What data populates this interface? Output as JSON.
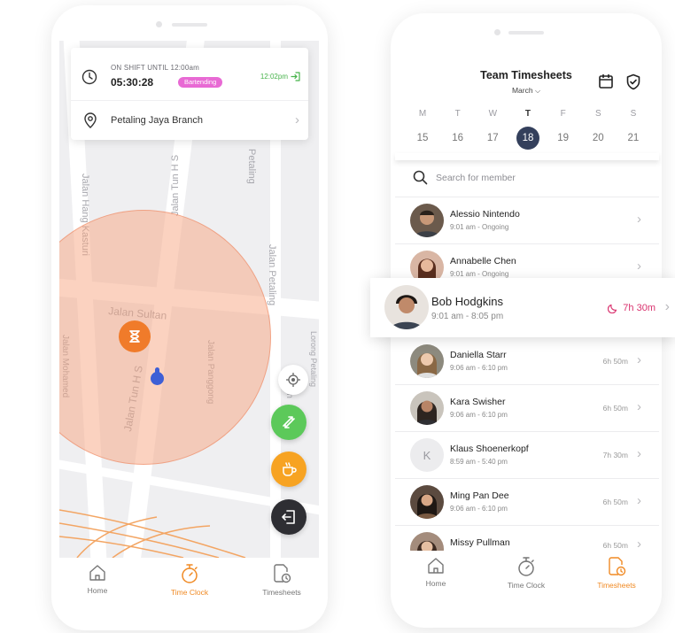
{
  "left_phone": {
    "shift": {
      "label": "ON SHIFT UNTIL 12:00am",
      "timer": "05:30:28",
      "role": "Bartending",
      "clock_in_time": "12:02pm"
    },
    "branch": {
      "name": "Petaling Jaya Branch"
    },
    "streets": {
      "hang_kasturi": "Jalan Hang Kasturi",
      "tun_hs_top": "Jalan Tun H S",
      "petaling_top": "Petaling",
      "sultan": "Jalan Sultan",
      "petaling": "Jalan Petaling",
      "tun_hs": "Jalan Tun H S",
      "panggong": "Jalan Panggong",
      "mohamed": "Jalan Mohamed",
      "lorong": "Lorong Petaling",
      "jalan_short": "Jalan"
    },
    "nav": [
      {
        "label": "Home"
      },
      {
        "label": "Time Clock"
      },
      {
        "label": "Timesheets"
      }
    ]
  },
  "right_phone": {
    "title": "Team Timesheets",
    "month": "March",
    "week": {
      "letters": [
        "M",
        "T",
        "W",
        "T",
        "F",
        "S",
        "S"
      ],
      "numbers": [
        "15",
        "16",
        "17",
        "18",
        "19",
        "20",
        "21"
      ]
    },
    "search": {
      "placeholder": "Search for member"
    },
    "members": [
      {
        "name": "Alessio Nintendo",
        "time": "9:01 am - Ongoing",
        "hours": ""
      },
      {
        "name": "Annabelle Chen",
        "time": "9:01 am - Ongoing",
        "hours": ""
      },
      {
        "name": "Daniella Starr",
        "time": "9:06 am - 6:10 pm",
        "hours": "6h 50m"
      },
      {
        "name": "Kara Swisher",
        "time": "9:06 am - 6:10 pm",
        "hours": "6h 50m"
      },
      {
        "name": "Klaus Shoenerkopf",
        "time": "8:59 am - 5:40 pm",
        "hours": "7h 30m",
        "initial": "K"
      },
      {
        "name": "Ming Pan Dee",
        "time": "9:06 am - 6:10 pm",
        "hours": "6h 50m"
      },
      {
        "name": "Missy Pullman",
        "time": "",
        "hours": "6h 50m"
      }
    ],
    "expanded": {
      "name": "Bob Hodgkins",
      "time": "9:01 am - 8:05 pm",
      "hours": "7h 30m"
    },
    "nav": [
      {
        "label": "Home"
      },
      {
        "label": "Time Clock"
      },
      {
        "label": "Timesheets"
      }
    ]
  },
  "colors": {
    "accent": "#f08a24",
    "role_badge": "#e86ad4",
    "clock_in_green": "#47b34b",
    "selected_day": "#34405c",
    "overtime": "#d9326e"
  }
}
